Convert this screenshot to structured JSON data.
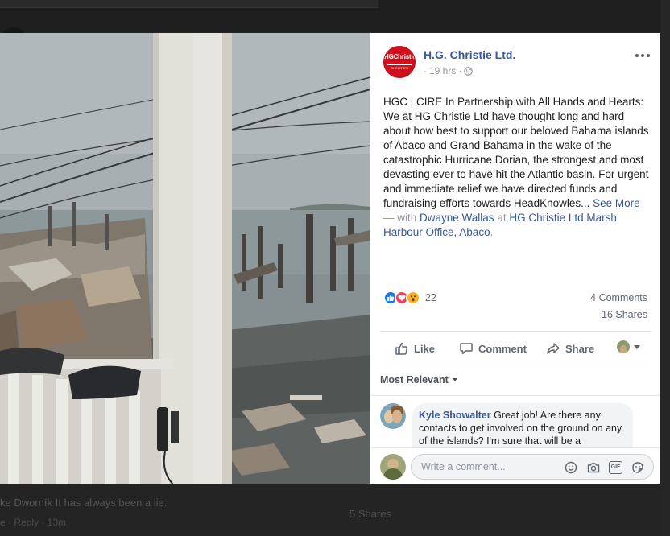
{
  "background": {
    "comment_text": "ke Dworník It has always been a lie.",
    "comment_meta": "e · Reply · 13m",
    "shares": "5 Shares"
  },
  "photo": {
    "subject": "porch-view-hurricane-debris-harbour",
    "colors": {
      "sky": "#b4babd",
      "water": "#8d979a",
      "column": "#e8e6df"
    }
  },
  "post": {
    "page_logo_text": "HGChristie",
    "page_logo_subtext": "CHRISTIE'S",
    "page_name": "H.G. Christie Ltd.",
    "time": "19 hrs",
    "privacy_icon": "globe-icon",
    "more_icon": "more-options-icon",
    "text_heading": "HGC | CIRE In Partnership with All Hands and Hearts:",
    "text_body": "We at HG Christie Ltd have thought long and hard about how best to support our beloved Bahama islands of Abaco and Grand Bahama in the wake of the catastrophic Hurricane Dorian, the strongest and most devasting ever to have hit the Atlantic basin. For urgent and immediate relief we have directed funds and fundraising efforts towards HeadKnowles...",
    "see_more": "See More",
    "with_prefix": "— with",
    "tagged_person": "Dwayne Wallas",
    "at_prefix": "at",
    "location": "HG Christie Ltd Marsh Harbour Office, Abaco",
    "location_suffix": "."
  },
  "stats": {
    "reaction_count": "22",
    "comments": "4 Comments",
    "shares": "16 Shares"
  },
  "actions": {
    "like": "Like",
    "comment": "Comment",
    "share": "Share"
  },
  "sort": {
    "label": "Most Relevant"
  },
  "comment": {
    "author": "Kyle Showalter",
    "text": "Great job! Are there any contacts to get involved on the ground on any of the islands? I'm sure that will be a"
  },
  "composer": {
    "placeholder": "Write a comment..."
  },
  "colors": {
    "link": "#385898",
    "brand_red": "#d0111b",
    "like_blue": "#1877f2"
  }
}
